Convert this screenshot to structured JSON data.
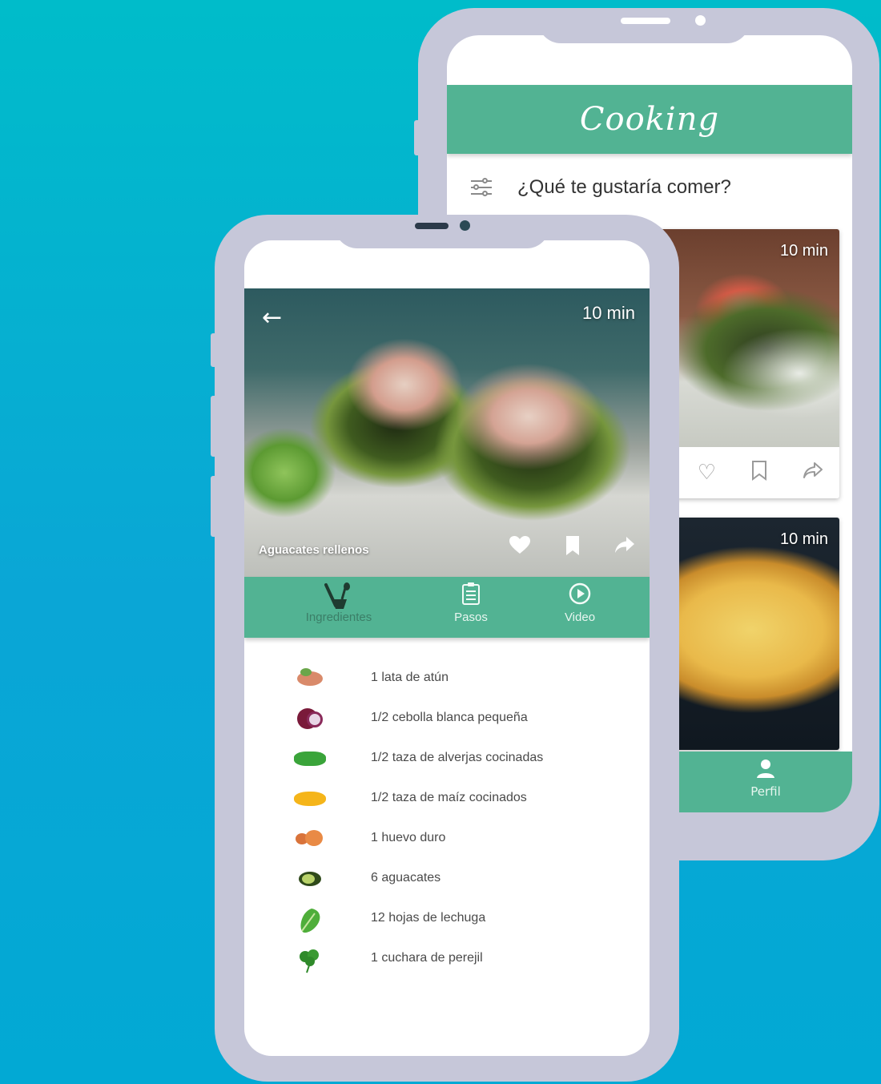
{
  "colors": {
    "accent": "#52b393",
    "phone_frame": "#c6c7d9",
    "background": "#0aa6d6"
  },
  "back_screen": {
    "header_title": "Cooking",
    "search_label": "¿Qué te gustaría comer?",
    "filter_icon": "filter-sliders-icon",
    "cards": [
      {
        "time": "10 min",
        "actions": [
          "heart-outline-icon",
          "bookmark-outline-icon",
          "share-outline-icon"
        ]
      },
      {
        "time": "10 min"
      }
    ],
    "bottom_nav": {
      "profile_label": "Perfil",
      "profile_icon": "person-icon"
    }
  },
  "front_screen": {
    "back_icon": "←",
    "time": "10 min",
    "recipe_title": "Aguacates rellenos",
    "action_icons": [
      "heart-icon",
      "bookmark-icon",
      "share-icon"
    ],
    "tabs": [
      {
        "label": "Ingredientes",
        "icon": "whisk-bowl-icon"
      },
      {
        "label": "Pasos",
        "icon": "clipboard-list-icon"
      },
      {
        "label": "Video",
        "icon": "play-circle-icon"
      }
    ],
    "ingredients": [
      {
        "text": "1 lata de atún",
        "icon": "tuna-icon"
      },
      {
        "text": "1/2 cebolla blanca pequeña",
        "icon": "onion-icon"
      },
      {
        "text": "1/2 taza de alverjas cocinadas",
        "icon": "peas-icon"
      },
      {
        "text": "1/2 taza de maíz cocinados",
        "icon": "corn-icon"
      },
      {
        "text": "1 huevo duro",
        "icon": "egg-icon"
      },
      {
        "text": "6 aguacates",
        "icon": "avocado-icon"
      },
      {
        "text": "12 hojas de lechuga",
        "icon": "lettuce-icon"
      },
      {
        "text": "1 cuchara de perejil",
        "icon": "parsley-icon"
      }
    ]
  }
}
